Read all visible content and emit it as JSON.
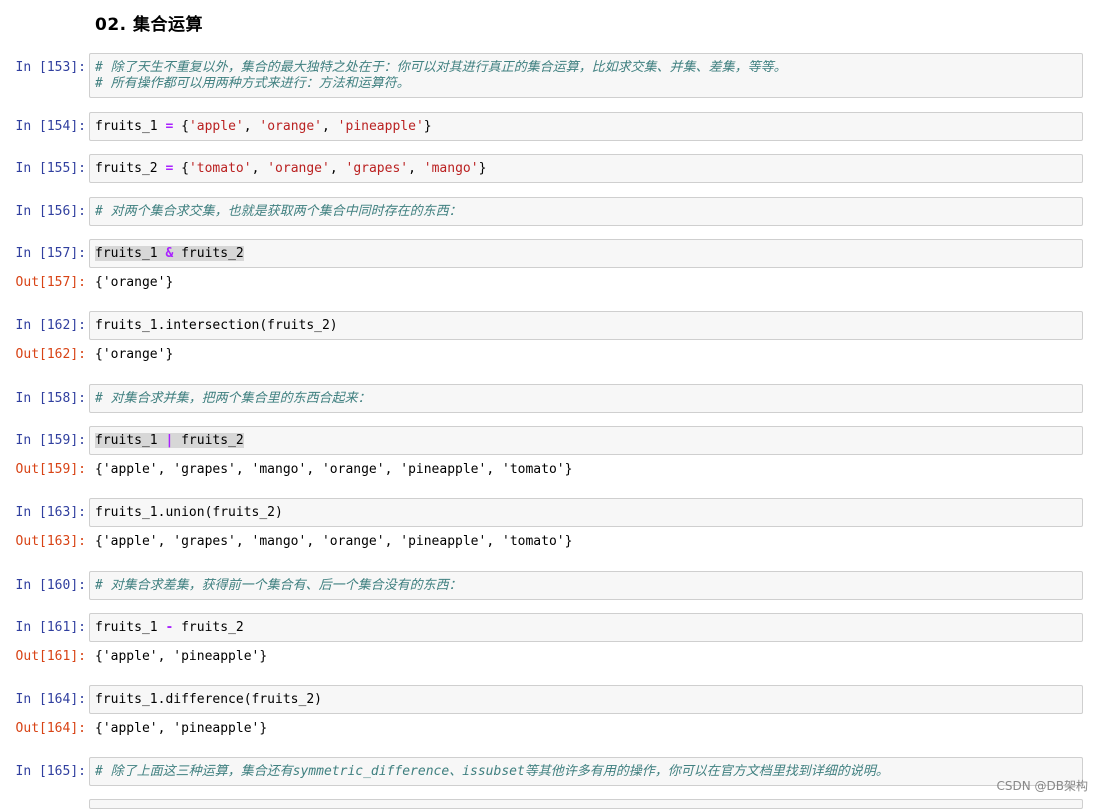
{
  "section_title": "02. 集合运算",
  "watermark": "CSDN @DB架构",
  "cells": [
    {
      "prompt": "In [153]:",
      "type": "comment",
      "lines": [
        "# 除了天生不重复以外，集合的最大独特之处在于：你可以对其进行真正的集合运算，比如求交集、并集、差集，等等。",
        "# 所有操作都可以用两种方式来进行：方法和运算符。"
      ]
    },
    {
      "prompt": "In [154]:",
      "type": "code",
      "tokens": [
        [
          "fruits_1 ",
          ""
        ],
        [
          "=",
          "op"
        ],
        [
          " {",
          ""
        ],
        [
          "'apple'",
          "str"
        ],
        [
          ", ",
          ""
        ],
        [
          "'orange'",
          "str"
        ],
        [
          ", ",
          ""
        ],
        [
          "'pineapple'",
          "str"
        ],
        [
          "}",
          ""
        ]
      ]
    },
    {
      "prompt": "In [155]:",
      "type": "code",
      "tokens": [
        [
          "fruits_2 ",
          ""
        ],
        [
          "=",
          "op"
        ],
        [
          " {",
          ""
        ],
        [
          "'tomato'",
          "str"
        ],
        [
          ", ",
          ""
        ],
        [
          "'orange'",
          "str"
        ],
        [
          ", ",
          ""
        ],
        [
          "'grapes'",
          "str"
        ],
        [
          ", ",
          ""
        ],
        [
          "'mango'",
          "str"
        ],
        [
          "}",
          ""
        ]
      ]
    },
    {
      "prompt": "In [156]:",
      "type": "comment",
      "lines": [
        "# 对两个集合求交集，也就是获取两个集合中同时存在的东西："
      ]
    },
    {
      "prompt": "In [157]:",
      "type": "code",
      "selected": true,
      "tokens": [
        [
          "fruits_1 ",
          ""
        ],
        [
          "&",
          "op"
        ],
        [
          " fruits_2",
          ""
        ]
      ],
      "out_prompt": "Out[157]:",
      "output": "{'orange'}"
    },
    {
      "prompt": "In [162]:",
      "type": "code",
      "tokens": [
        [
          "fruits_1.intersection(fruits_2)",
          ""
        ]
      ],
      "out_prompt": "Out[162]:",
      "output": "{'orange'}"
    },
    {
      "prompt": "In [158]:",
      "type": "comment",
      "lines": [
        "# 对集合求并集，把两个集合里的东西合起来："
      ]
    },
    {
      "prompt": "In [159]:",
      "type": "code",
      "selected": true,
      "tokens": [
        [
          "fruits_1 ",
          ""
        ],
        [
          "|",
          "op"
        ],
        [
          " fruits_2",
          ""
        ]
      ],
      "out_prompt": "Out[159]:",
      "output": "{'apple', 'grapes', 'mango', 'orange', 'pineapple', 'tomato'}"
    },
    {
      "prompt": "In [163]:",
      "type": "code",
      "tokens": [
        [
          "fruits_1.union(fruits_2)",
          ""
        ]
      ],
      "out_prompt": "Out[163]:",
      "output": "{'apple', 'grapes', 'mango', 'orange', 'pineapple', 'tomato'}"
    },
    {
      "prompt": "In [160]:",
      "type": "comment",
      "lines": [
        "# 对集合求差集，获得前一个集合有、后一个集合没有的东西："
      ]
    },
    {
      "prompt": "In [161]:",
      "type": "code",
      "tokens": [
        [
          "fruits_1 ",
          ""
        ],
        [
          "-",
          "op"
        ],
        [
          " fruits_2",
          ""
        ]
      ],
      "out_prompt": "Out[161]:",
      "output": "{'apple', 'pineapple'}"
    },
    {
      "prompt": "In [164]:",
      "type": "code",
      "tokens": [
        [
          "fruits_1.difference(fruits_2)",
          ""
        ]
      ],
      "out_prompt": "Out[164]:",
      "output": "{'apple', 'pineapple'}"
    },
    {
      "prompt": "In [165]:",
      "type": "comment",
      "lines": [
        "# 除了上面这三种运算，集合还有symmetric_difference、issubset等其他许多有用的操作，你可以在官方文档里找到详细的说明。"
      ]
    }
  ]
}
